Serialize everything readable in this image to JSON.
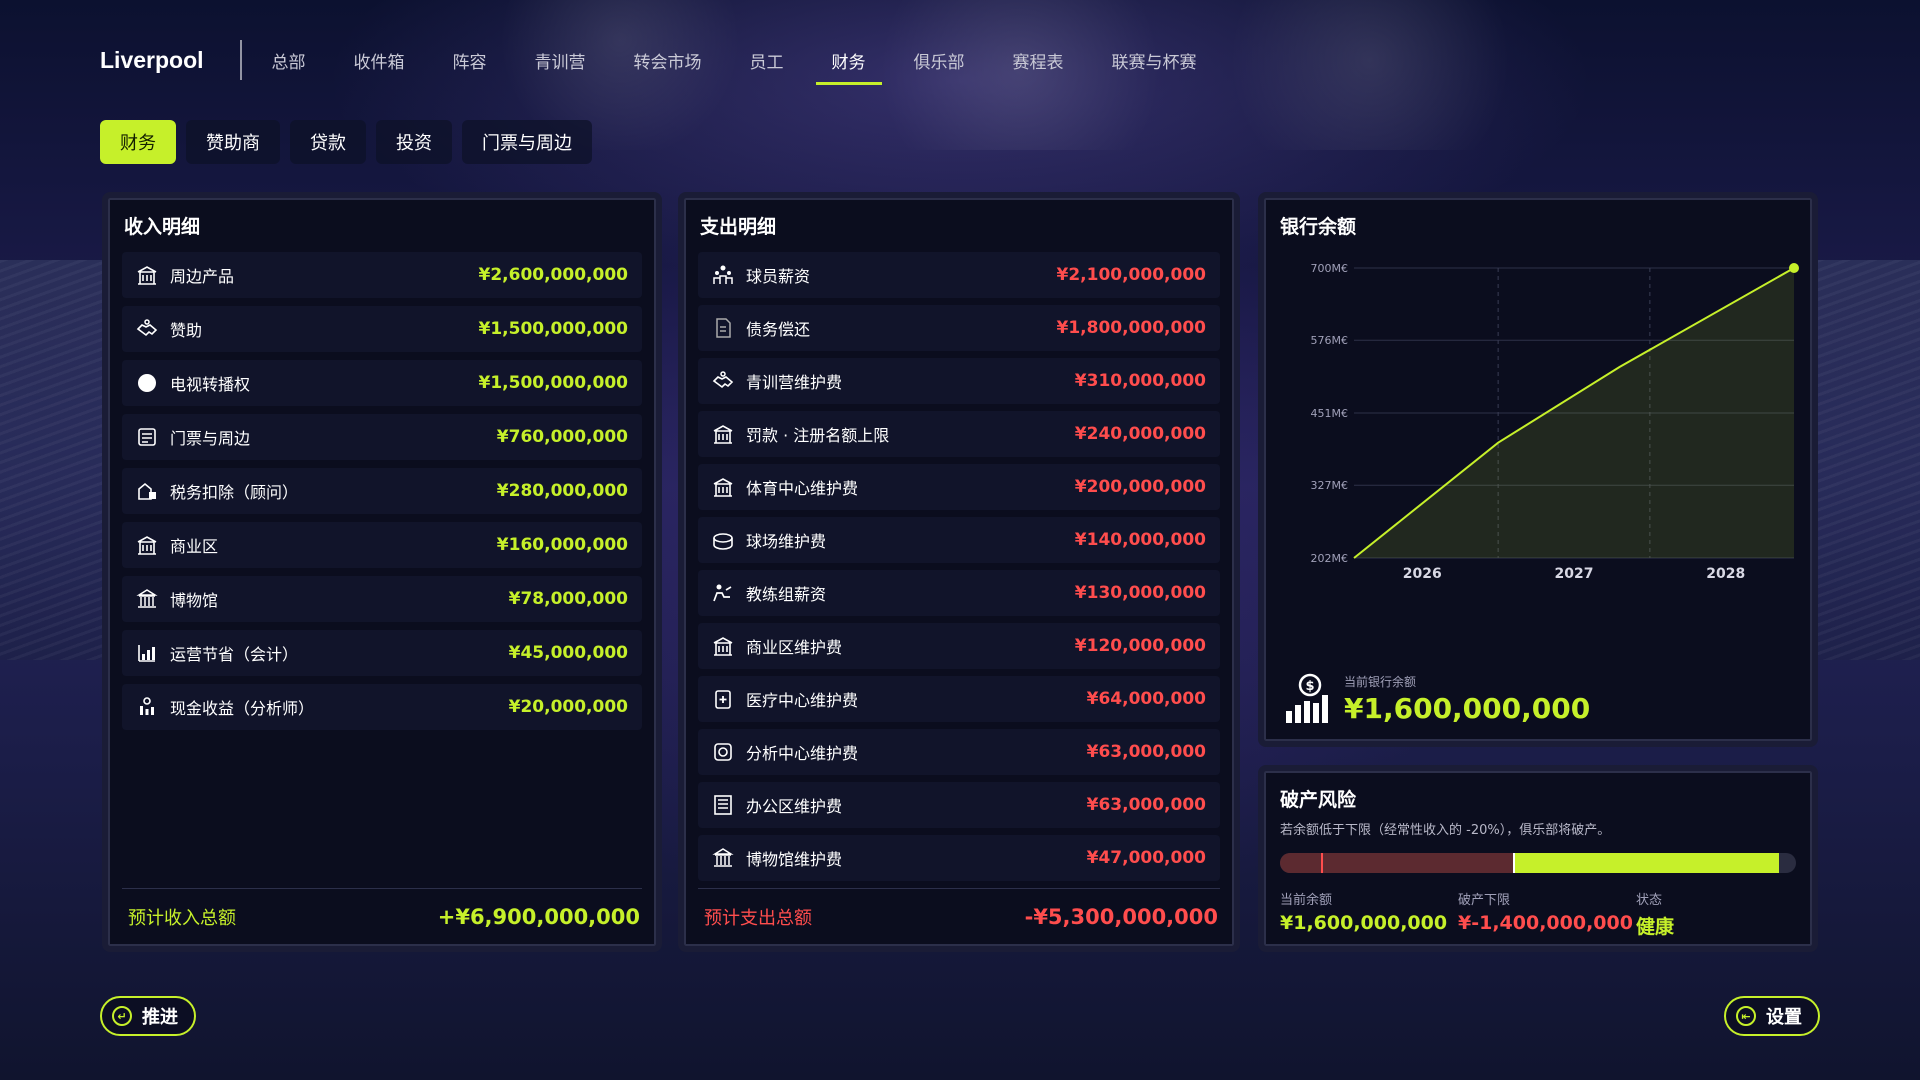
{
  "club": {
    "name": "Liverpool"
  },
  "nav": {
    "items": [
      {
        "label": "总部",
        "active": false
      },
      {
        "label": "收件箱",
        "active": false
      },
      {
        "label": "阵容",
        "active": false
      },
      {
        "label": "青训营",
        "active": false
      },
      {
        "label": "转会市场",
        "active": false
      },
      {
        "label": "员工",
        "active": false
      },
      {
        "label": "财务",
        "active": true
      },
      {
        "label": "俱乐部",
        "active": false
      },
      {
        "label": "赛程表",
        "active": false
      },
      {
        "label": "联赛与杯赛",
        "active": false
      }
    ]
  },
  "subtabs": [
    {
      "label": "财务",
      "active": true
    },
    {
      "label": "赞助商",
      "active": false
    },
    {
      "label": "贷款",
      "active": false
    },
    {
      "label": "投资",
      "active": false
    },
    {
      "label": "门票与周边",
      "active": false
    }
  ],
  "income": {
    "title": "收入明细",
    "rows": [
      {
        "icon": "building-icon",
        "label": "周边产品",
        "amount": "¥2,600,000,000"
      },
      {
        "icon": "handshake-icon",
        "label": "赞助",
        "amount": "¥1,500,000,000"
      },
      {
        "icon": "circle-icon",
        "label": "电视转播权",
        "amount": "¥1,500,000,000"
      },
      {
        "icon": "ticket-icon",
        "label": "门票与周边",
        "amount": "¥760,000,000"
      },
      {
        "icon": "tax-icon",
        "label": "税务扣除（顾问）",
        "amount": "¥280,000,000"
      },
      {
        "icon": "building-icon",
        "label": "商业区",
        "amount": "¥160,000,000"
      },
      {
        "icon": "museum-icon",
        "label": "博物馆",
        "amount": "¥78,000,000"
      },
      {
        "icon": "chart-icon",
        "label": "运营节省（会计）",
        "amount": "¥45,000,000"
      },
      {
        "icon": "cash-icon",
        "label": "现金收益（分析师）",
        "amount": "¥20,000,000"
      }
    ],
    "total_label": "预计收入总额",
    "total_value": "+¥6,900,000,000"
  },
  "expense": {
    "title": "支出明细",
    "rows": [
      {
        "icon": "team-icon",
        "label": "球员薪资",
        "amount": "¥2,100,000,000"
      },
      {
        "icon": "document-icon",
        "label": "债务偿还",
        "amount": "¥1,800,000,000"
      },
      {
        "icon": "handshake-icon",
        "label": "青训营维护费",
        "amount": "¥310,000,000"
      },
      {
        "icon": "building-icon",
        "label": "罚款 · 注册名额上限",
        "amount": "¥240,000,000"
      },
      {
        "icon": "building-icon",
        "label": "体育中心维护费",
        "amount": "¥200,000,000"
      },
      {
        "icon": "stadium-icon",
        "label": "球场维护费",
        "amount": "¥140,000,000"
      },
      {
        "icon": "coach-icon",
        "label": "教练组薪资",
        "amount": "¥130,000,000"
      },
      {
        "icon": "building-icon",
        "label": "商业区维护费",
        "amount": "¥120,000,000"
      },
      {
        "icon": "medical-icon",
        "label": "医疗中心维护费",
        "amount": "¥64,000,000"
      },
      {
        "icon": "analysis-icon",
        "label": "分析中心维护费",
        "amount": "¥63,000,000"
      },
      {
        "icon": "office-icon",
        "label": "办公区维护费",
        "amount": "¥63,000,000"
      },
      {
        "icon": "museum-icon",
        "label": "博物馆维护费",
        "amount": "¥47,000,000"
      }
    ],
    "total_label": "预计支出总额",
    "total_value": "-¥5,300,000,000"
  },
  "bank": {
    "title": "银行余额",
    "caption": "当前银行余额",
    "value": "¥1,600,000,000"
  },
  "chart_data": {
    "type": "area",
    "x": [
      2025.55,
      2026.5,
      2027.3,
      2028.45
    ],
    "y": [
      202,
      400,
      530,
      700
    ],
    "xticks": [
      "2026",
      "2027",
      "2028"
    ],
    "xtick_values": [
      2026,
      2027,
      2028
    ],
    "yticks": [
      "202M€",
      "327M€",
      "451M€",
      "576M€",
      "700M€"
    ],
    "ytick_values": [
      202,
      327,
      451,
      576,
      700
    ],
    "xlim": [
      2025.55,
      2028.45
    ],
    "ylim": [
      202,
      700
    ],
    "grid": true,
    "color": "#c6f02a"
  },
  "risk": {
    "title": "破产风险",
    "desc": "若余额低于下限（经常性收入的 -20%），俱乐部将破产。",
    "balance_caption": "当前余额",
    "balance_value": "¥1,600,000,000",
    "floor_caption": "破产下限",
    "floor_value": "¥-1,400,000,000",
    "status_caption": "状态",
    "status_value": "健康",
    "bar_min": -1400,
    "bar_max": 1700,
    "balance": 1600,
    "floor": -1400
  },
  "buttons": {
    "advance": "推进",
    "settings": "设置"
  },
  "colors": {
    "accent": "#c6f02a",
    "negative": "#ff4d4d"
  }
}
